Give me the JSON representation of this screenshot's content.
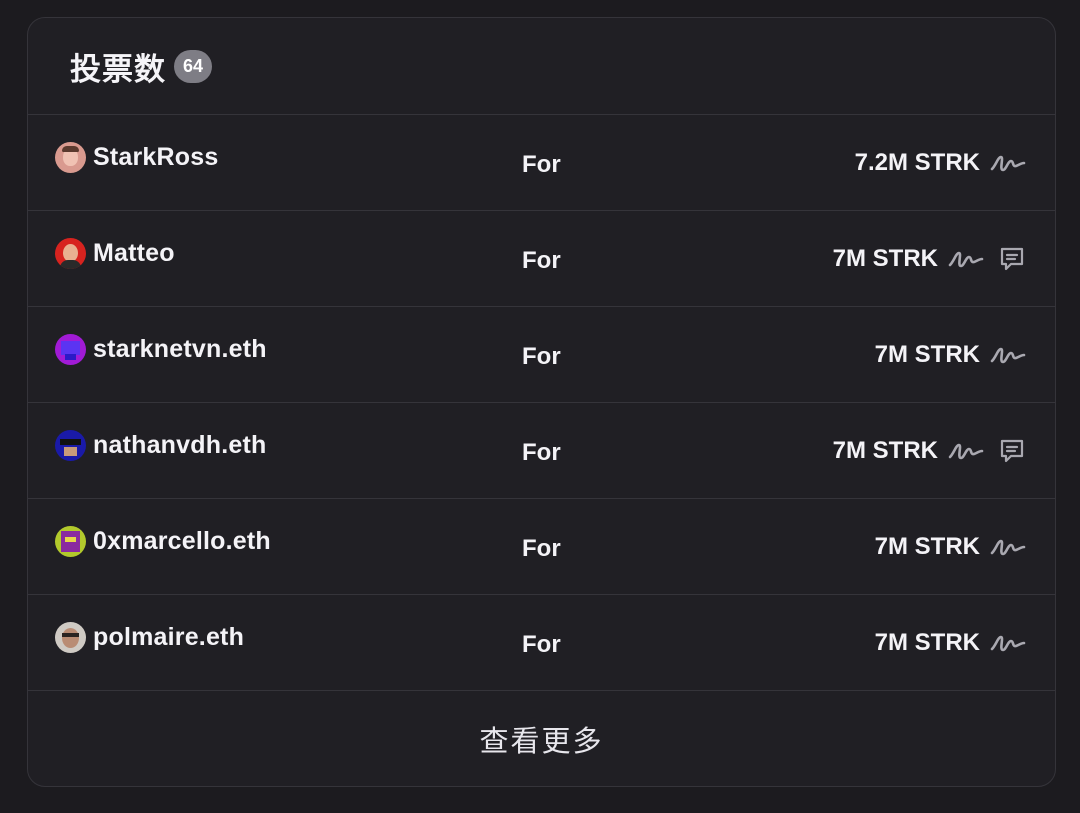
{
  "header": {
    "title": "投票数",
    "count": "64"
  },
  "votes": [
    {
      "voter": "StarkRoss",
      "avatar": "stark-avatar",
      "choice": "For",
      "power": "7.2M STRK",
      "signature_icon": "signature-icon",
      "has_comment": false
    },
    {
      "voter": "Matteo",
      "avatar": "matteo-avatar",
      "choice": "For",
      "power": "7M STRK",
      "signature_icon": "signature-icon",
      "has_comment": true
    },
    {
      "voter": "starknetvn.eth",
      "avatar": "starknetvn-avatar",
      "choice": "For",
      "power": "7M STRK",
      "signature_icon": "signature-icon",
      "has_comment": false
    },
    {
      "voter": "nathanvdh.eth",
      "avatar": "nathan-avatar",
      "choice": "For",
      "power": "7M STRK",
      "signature_icon": "signature-icon",
      "has_comment": true
    },
    {
      "voter": "0xmarcello.eth",
      "avatar": "marcello-avatar",
      "choice": "For",
      "power": "7M STRK",
      "signature_icon": "signature-icon",
      "has_comment": false
    },
    {
      "voter": "polmaire.eth",
      "avatar": "polmaire-avatar",
      "choice": "For",
      "power": "7M STRK",
      "signature_icon": "signature-icon",
      "has_comment": false
    }
  ],
  "footer": {
    "see_more_label": "查看更多"
  },
  "colors": {
    "background": "#1c1b1f",
    "card": "#201f24",
    "border": "#35343a",
    "text": "#f4f3f7",
    "badge": "#7e7d85",
    "icon": "#a9a8b0"
  }
}
